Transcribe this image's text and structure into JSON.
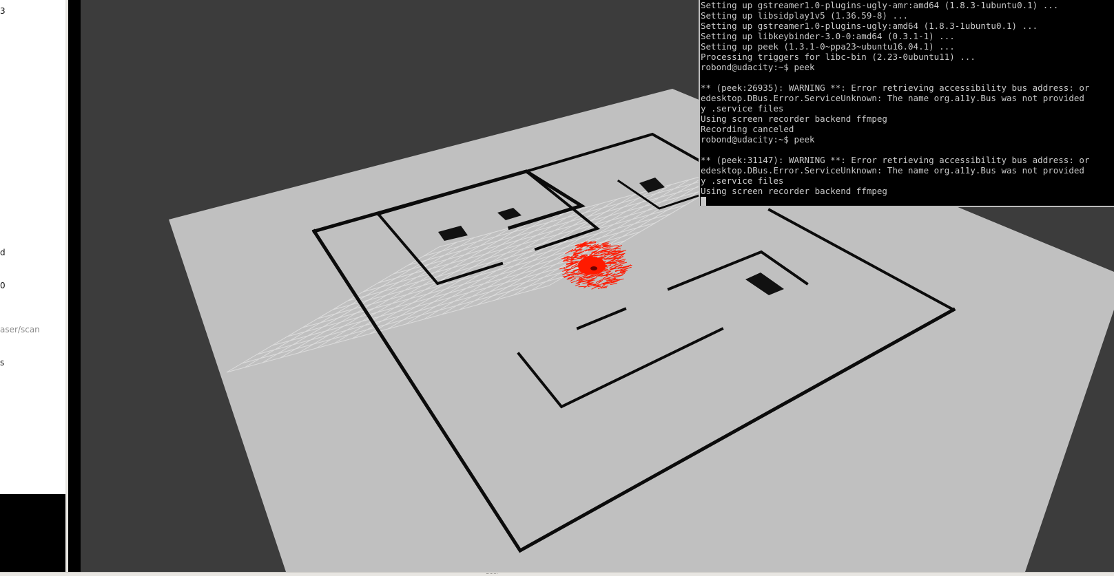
{
  "left_panel": {
    "fragments": [
      {
        "text": "3",
        "dim": false
      },
      {
        "text": "d",
        "dim": false
      },
      {
        "text": "0",
        "dim": false
      },
      {
        "text": "aser/scan",
        "dim": true
      },
      {
        "text": "s",
        "dim": false
      }
    ]
  },
  "terminal": {
    "lines": [
      "Setting up gstreamer1.0-plugins-ugly-amr:amd64 (1.8.3-1ubuntu0.1) ...",
      "Setting up libsidplay1v5 (1.36.59-8) ...",
      "Setting up gstreamer1.0-plugins-ugly:amd64 (1.8.3-1ubuntu0.1) ...",
      "Setting up libkeybinder-3.0-0:amd64 (0.3.1-1) ...",
      "Setting up peek (1.3.1-0~ppa23~ubuntu16.04.1) ...",
      "Processing triggers for libc-bin (2.23-0ubuntu11) ...",
      "robond@udacity:~$ peek",
      "",
      "** (peek:26935): WARNING **: Error retrieving accessibility bus address: or",
      "edesktop.DBus.Error.ServiceUnknown: The name org.a11y.Bus was not provided",
      "y .service files",
      "Using screen recorder backend ffmpeg",
      "Recording canceled",
      "robond@udacity:~$ peek",
      "",
      "** (peek:31147): WARNING **: Error retrieving accessibility bus address: or",
      "edesktop.DBus.Error.ServiceUnknown: The name org.a11y.Bus was not provided",
      "y .service files",
      "Using screen recorder backend ffmpeg"
    ]
  },
  "viewport": {
    "background_color": "#3c3c3c",
    "floor_color": "#c0c0c0",
    "wall_color": "#0b0b0b",
    "grid_color": "#dcdcdc",
    "particle_color": "#ff1a00"
  }
}
